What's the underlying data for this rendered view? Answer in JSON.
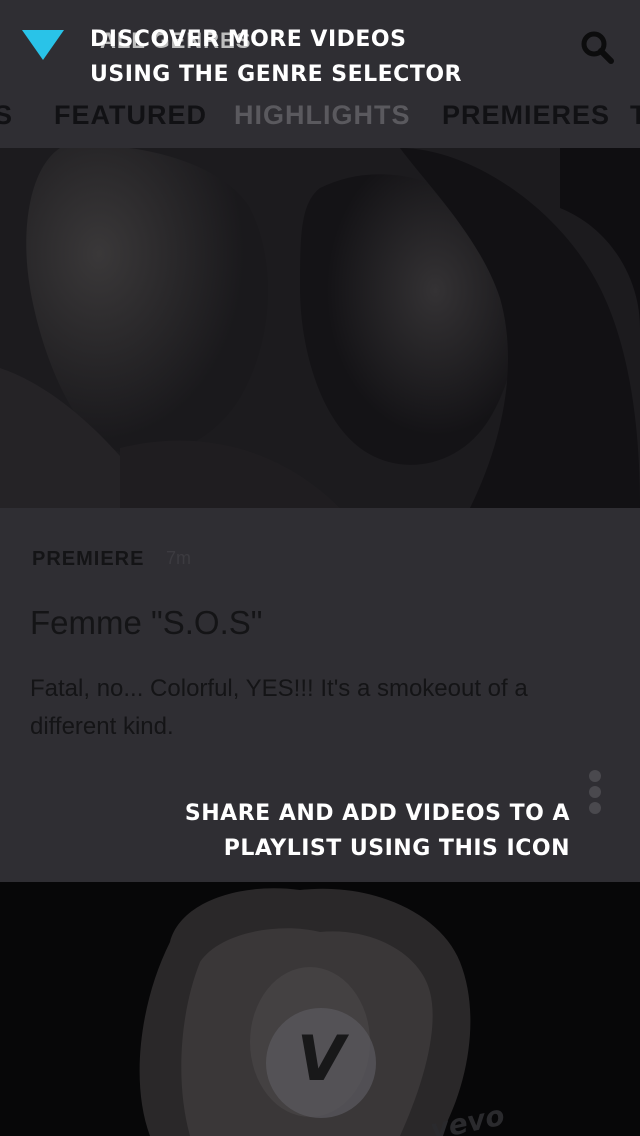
{
  "header": {
    "genre_label": "ALL GENRES",
    "search_icon": "search-icon"
  },
  "tabs": [
    {
      "label": "S"
    },
    {
      "label": "FEATURED"
    },
    {
      "label": "HIGHLIGHTS",
      "active": true
    },
    {
      "label": "PREMIERES"
    },
    {
      "label": "T"
    }
  ],
  "card": {
    "kind": "PREMIERE",
    "time": "7m",
    "title": "Femme \"S.O.S\"",
    "description": "Fatal, no... Colorful, YES!!!  It's a smokeout of a different kind.",
    "more_icon": "more-vertical-icon"
  },
  "video2": {
    "badge_letter": "V",
    "watermark": "vevo"
  },
  "coach_marks": {
    "genre_tip_line1": "DISCOVER MORE VIDEOS",
    "genre_tip_line2": "USING THE GENRE SELECTOR",
    "share_tip_line1": "SHARE AND ADD VIDEOS TO A",
    "share_tip_line2": "PLAYLIST USING THIS ICON",
    "arrow_color": "#29c3e8"
  },
  "colors": {
    "header_bg": "#2f2e33",
    "accent": "#29c3e8"
  }
}
